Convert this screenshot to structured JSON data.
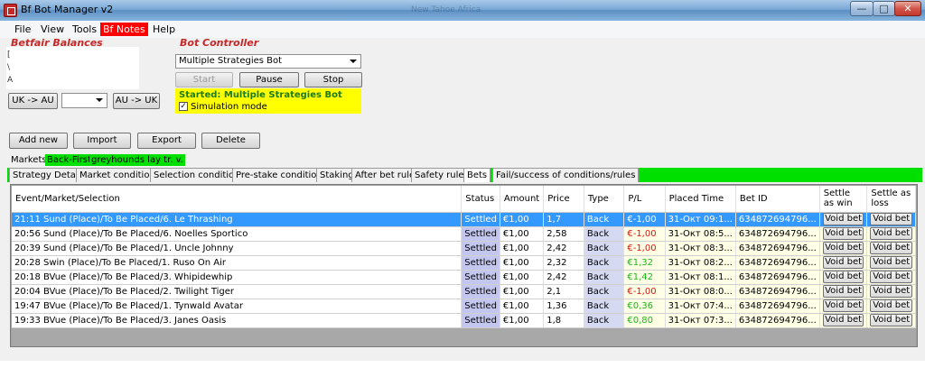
{
  "window": {
    "title": "Bf Bot Manager v2",
    "ghost_text": "New Tahoe Africa"
  },
  "menu": [
    "File",
    "View",
    "Tools",
    "Bf Notes",
    "Help"
  ],
  "balances": {
    "label": "Betfair Balances",
    "lines": [
      "[",
      "\\",
      "A"
    ],
    "uk_au_button": "UK -> AU",
    "au_uk_button": "AU -> UK",
    "currency_select": ""
  },
  "bot_controller": {
    "label": "Bot Controller",
    "strategy": "Multiple Strategies Bot",
    "start": "Start",
    "pause": "Pause",
    "stop": "Stop",
    "status": "Started: Multiple Strategies Bot",
    "sim_label": "Simulation mode",
    "sim_checked": true
  },
  "actions": {
    "add_new": "Add new",
    "import": "Import",
    "export": "Export",
    "delete": "Delete"
  },
  "markets_tabs": [
    "Markets",
    "Back-First",
    "greyhounds lay tr. v."
  ],
  "sub_tabs": [
    "Strategy Details",
    "Market conditions",
    "Selection conditions",
    "Pre-stake conditions",
    "Staking",
    "After bet rules",
    "Safety rules",
    "Bets",
    "Fail/success of conditions/rules"
  ],
  "active_sub_tab": "Bets",
  "columns": [
    "Event/Market/Selection",
    "Status",
    "Amount",
    "Price",
    "Type",
    "P/L",
    "Placed Time",
    "Bet ID",
    "Settle as win",
    "Settle as loss"
  ],
  "bets": [
    {
      "event": "21:11 Sund  (Place)/To Be Placed/6. Le Thrashing",
      "status": "Settled",
      "amount": "€1,00",
      "price": "1,7",
      "type": "Back",
      "pl": "€-1,00",
      "pl_sign": "neg",
      "time": "31-Окт 09:1...",
      "bet_id": "634872694796...",
      "win": "Void bet",
      "loss": "Void bet",
      "selected": true
    },
    {
      "event": "20:56 Sund  (Place)/To Be Placed/6. Noelles Sportico",
      "status": "Settled",
      "amount": "€1,00",
      "price": "2,58",
      "type": "Back",
      "pl": "€-1,00",
      "pl_sign": "neg",
      "time": "31-Окт 08:5...",
      "bet_id": "634872694796...",
      "win": "Void bet",
      "loss": "Void bet",
      "selected": false
    },
    {
      "event": "20:39 Sund  (Place)/To Be Placed/1. Uncle Johnny",
      "status": "Settled",
      "amount": "€1,00",
      "price": "2,42",
      "type": "Back",
      "pl": "€-1,00",
      "pl_sign": "neg",
      "time": "31-Окт 08:3...",
      "bet_id": "634872694796...",
      "win": "Void bet",
      "loss": "Void bet",
      "selected": false
    },
    {
      "event": "20:28 Swin  (Place)/To Be Placed/1. Ruso On Air",
      "status": "Settled",
      "amount": "€1,00",
      "price": "2,32",
      "type": "Back",
      "pl": "€1,32",
      "pl_sign": "pos",
      "time": "31-Окт 08:2...",
      "bet_id": "634872694796...",
      "win": "Void bet",
      "loss": "Void bet",
      "selected": false
    },
    {
      "event": "20:18 BVue  (Place)/To Be Placed/3. Whipidewhip",
      "status": "Settled",
      "amount": "€1,00",
      "price": "2,42",
      "type": "Back",
      "pl": "€1,42",
      "pl_sign": "pos",
      "time": "31-Окт 08:1...",
      "bet_id": "634872694796...",
      "win": "Void bet",
      "loss": "Void bet",
      "selected": false
    },
    {
      "event": "20:04 BVue  (Place)/To Be Placed/2. Twilight Tiger",
      "status": "Settled",
      "amount": "€1,00",
      "price": "2,1",
      "type": "Back",
      "pl": "€-1,00",
      "pl_sign": "neg",
      "time": "31-Окт 08:0...",
      "bet_id": "634872694796...",
      "win": "Void bet",
      "loss": "Void bet",
      "selected": false
    },
    {
      "event": "19:47 BVue  (Place)/To Be Placed/1. Tynwald Avatar",
      "status": "Settled",
      "amount": "€1,00",
      "price": "1,36",
      "type": "Back",
      "pl": "€0,36",
      "pl_sign": "pos",
      "time": "31-Окт 07:4...",
      "bet_id": "634872694796...",
      "win": "Void bet",
      "loss": "Void bet",
      "selected": false
    },
    {
      "event": "19:33 BVue  (Place)/To Be Placed/3. Janes Oasis",
      "status": "Settled",
      "amount": "€1,00",
      "price": "1,8",
      "type": "Back",
      "pl": "€0,80",
      "pl_sign": "pos",
      "time": "31-Окт 07:3...",
      "bet_id": "634872694796...",
      "win": "Void bet",
      "loss": "Void bet",
      "selected": false
    }
  ],
  "colors": {
    "accent_red": "#c62828",
    "status_yellow": "#ffff00",
    "tab_green": "#00e000",
    "selection_blue": "#3399ff",
    "pl_positive": "#18b818",
    "pl_negative": "#e01010"
  }
}
